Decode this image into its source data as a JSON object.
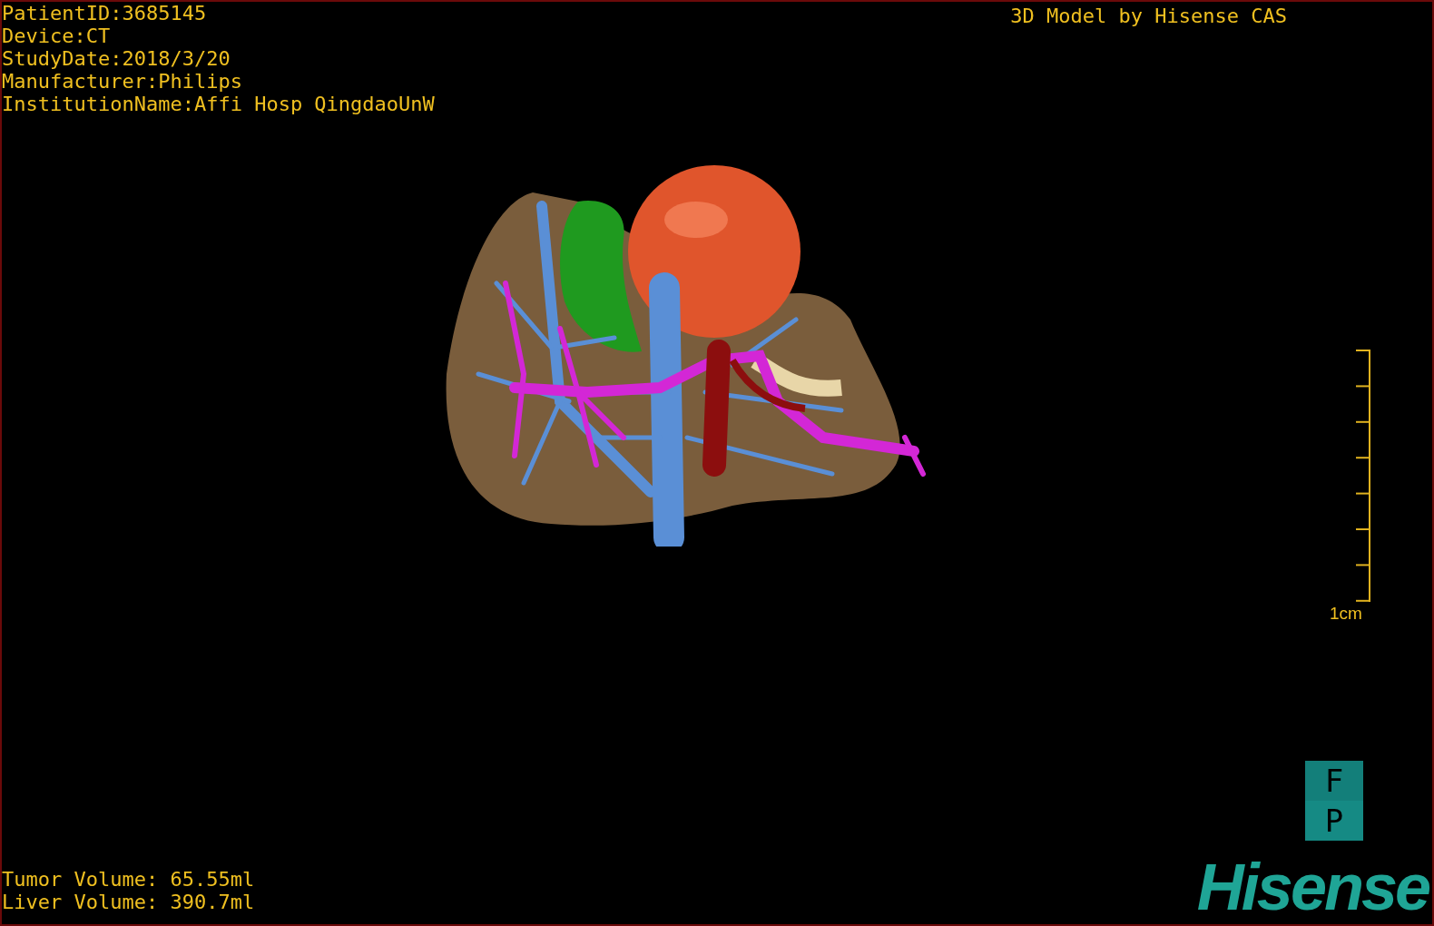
{
  "patient_info": [
    "PatientID:3685145",
    "Device:CT",
    "StudyDate:2018/3/20",
    "Manufacturer:Philips",
    "InstitutionName:Affi Hosp QingdaoUnW"
  ],
  "model_title": "3D Model by Hisense CAS",
  "scale": {
    "label": "1cm"
  },
  "orientation_labels": [
    "F",
    "P"
  ],
  "volumes": [
    "Tumor Volume: 65.55ml",
    "Liver Volume: 390.7ml"
  ],
  "logo": "Hisense"
}
